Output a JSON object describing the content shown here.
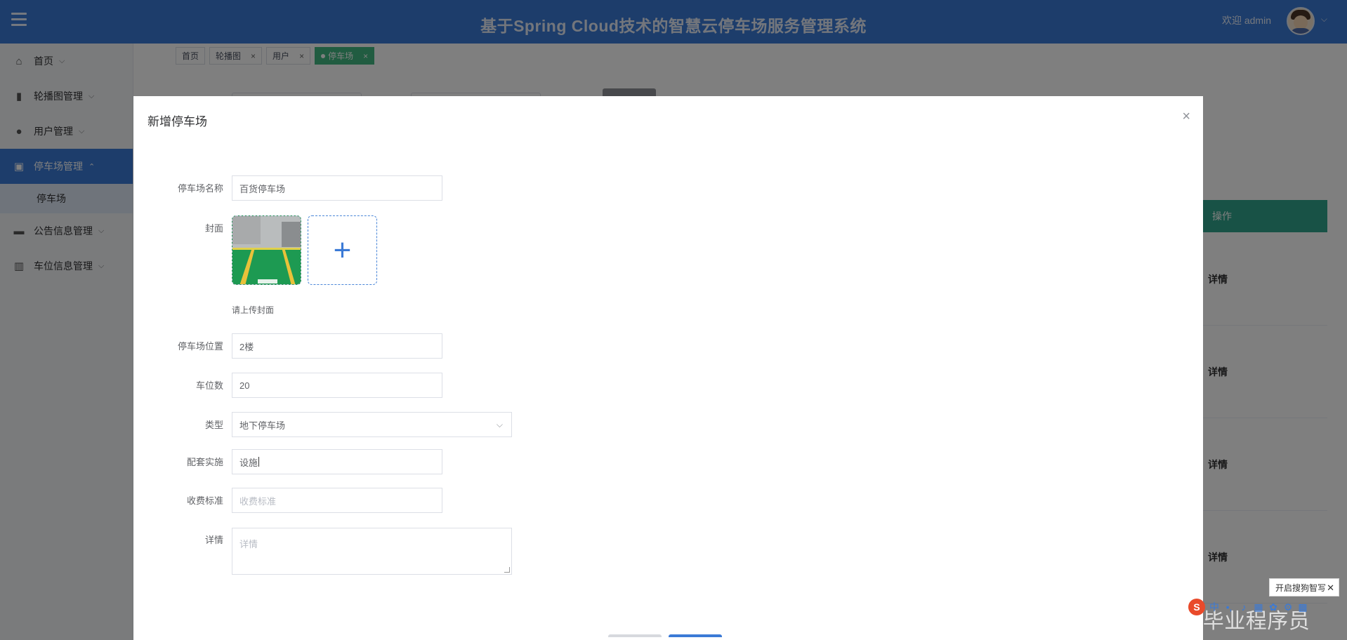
{
  "header": {
    "title": "基于Spring Cloud技术的智慧云停车场服务管理系统",
    "welcome": "欢迎 admin",
    "caret": "⌵"
  },
  "sidebar": {
    "items": [
      {
        "label": "首页",
        "icon": "home-icon",
        "glyph": "⌂"
      },
      {
        "label": "轮播图管理",
        "icon": "carousel-icon",
        "glyph": "▮"
      },
      {
        "label": "用户管理",
        "icon": "user-icon",
        "glyph": "●"
      },
      {
        "label": "停车场管理",
        "icon": "parking-icon",
        "glyph": "▣"
      },
      {
        "label": "公告信息管理",
        "icon": "notice-icon",
        "glyph": "▬"
      },
      {
        "label": "车位信息管理",
        "icon": "stats-icon",
        "glyph": "▥"
      }
    ],
    "sub_item": "停车场",
    "expand_arrow": "⌵",
    "collapse_arrow": "⌃"
  },
  "tabs": [
    {
      "label": "首页",
      "closable": false
    },
    {
      "label": "轮播图",
      "closable": true
    },
    {
      "label": "用户",
      "closable": true
    },
    {
      "label": "停车场",
      "closable": true,
      "active": true
    }
  ],
  "background": {
    "table_header": "操作",
    "row_action": "详情"
  },
  "dialog": {
    "title": "新增停车场",
    "close": "×",
    "fields": {
      "name": {
        "label": "停车场名称",
        "value": "百货停车场"
      },
      "cover": {
        "label": "封面",
        "hint": "请上传封面",
        "add": "+"
      },
      "location": {
        "label": "停车场位置",
        "value": "2楼"
      },
      "spaces": {
        "label": "车位数",
        "value": "20"
      },
      "type": {
        "label": "类型",
        "value": "地下停车场"
      },
      "facilities": {
        "label": "配套实施",
        "value": "设施"
      },
      "fee": {
        "label": "收费标准",
        "placeholder": "收费标准"
      },
      "detail": {
        "label": "详情",
        "placeholder": "详情"
      }
    }
  },
  "ime": {
    "tip": "开启搜狗智写",
    "logo": "S",
    "lang": "中",
    "close": "✕"
  },
  "watermark": "CSDN @毕业程序员",
  "colors": {
    "header": "#3b7ad6",
    "active_tab": "#42b983",
    "table_header": "#31a58d"
  }
}
